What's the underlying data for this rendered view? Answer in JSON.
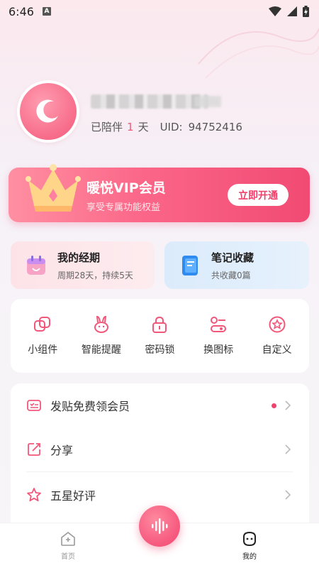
{
  "status_bar": {
    "time": "6:46",
    "notification_badge": "A",
    "icons": [
      "wifi-icon",
      "signal-icon",
      "battery-charging-icon"
    ]
  },
  "profile": {
    "avatar_icon": "crescent-moon-icon",
    "days_prefix": "已陪伴",
    "days_value": "1",
    "days_suffix": "天",
    "uid_label": "UID:",
    "uid_value": "94752416"
  },
  "vip": {
    "title": "暖悦VIP会员",
    "subtitle": "享受专属功能权益",
    "button": "立即开通",
    "icon": "crown-icon"
  },
  "features": [
    {
      "title": "我的经期",
      "subtitle": "周期28天，持续5天",
      "icon": "calendar-icon"
    },
    {
      "title": "笔记收藏",
      "subtitle": "共收藏0篇",
      "icon": "notebook-icon"
    }
  ],
  "tools": [
    {
      "label": "小组件",
      "icon": "widget-icon"
    },
    {
      "label": "智能提醒",
      "icon": "bunny-reminder-icon"
    },
    {
      "label": "密码锁",
      "icon": "lock-icon"
    },
    {
      "label": "换图标",
      "icon": "switch-icon-icon"
    },
    {
      "label": "自定义",
      "icon": "star-custom-icon"
    }
  ],
  "menu": [
    {
      "label": "发贴免费领会员",
      "icon": "ticket-icon",
      "has_dot": true
    },
    {
      "label": "分享",
      "icon": "share-icon",
      "has_dot": false
    },
    {
      "label": "五星好评",
      "icon": "star-icon",
      "has_dot": false
    }
  ],
  "bottom_nav": {
    "home_label": "首页",
    "mine_label": "我的",
    "fab_icon": "voice-wave-icon"
  },
  "colors": {
    "accent": "#f2577a",
    "vip_gradient_start": "#ff8fa2",
    "vip_gradient_end": "#f14a73"
  }
}
